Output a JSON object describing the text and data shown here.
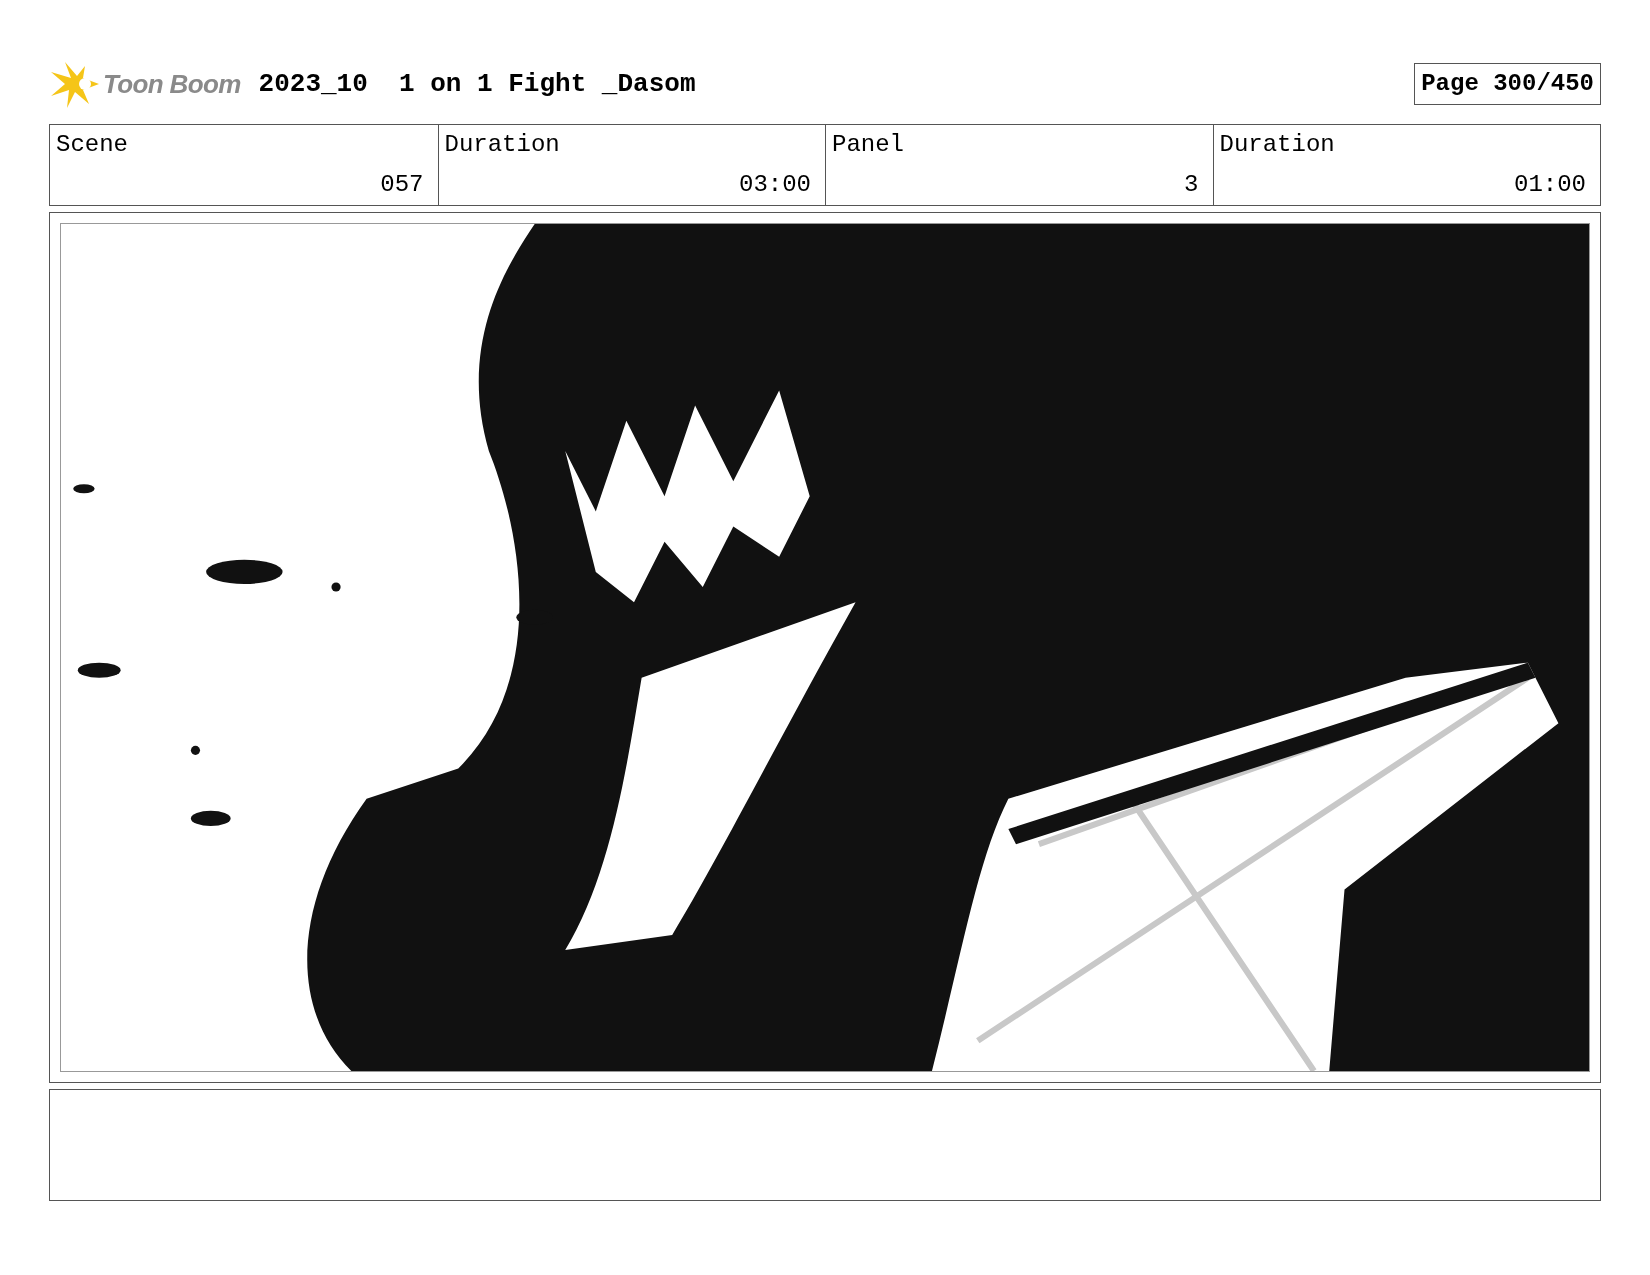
{
  "logo": {
    "text": "Toon Boom"
  },
  "title": "2023_10  1 on 1 Fight _Dasom",
  "page": "Page 300/450",
  "fields": [
    {
      "label": "Scene",
      "value": "057"
    },
    {
      "label": "Duration",
      "value": "03:00"
    },
    {
      "label": "Panel",
      "value": "3"
    },
    {
      "label": "Duration",
      "value": "01:00"
    }
  ]
}
